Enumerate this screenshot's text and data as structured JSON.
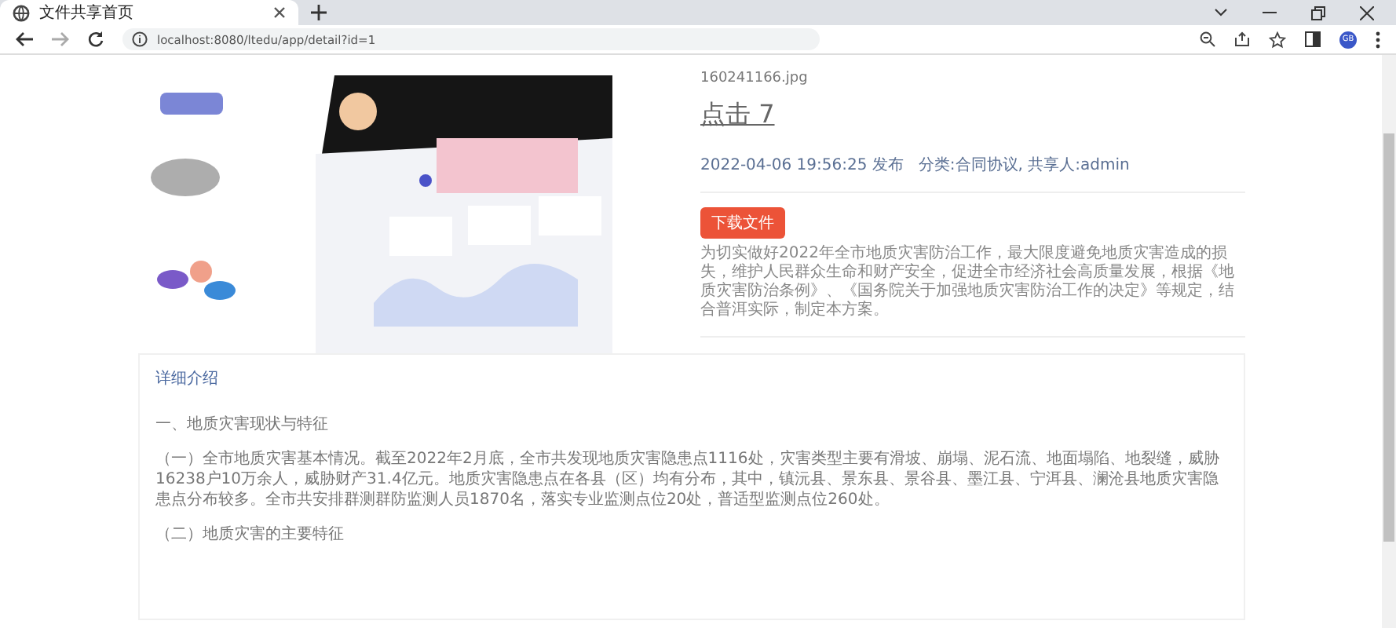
{
  "browser": {
    "tab": {
      "title": "文件共享首页",
      "selected": true
    },
    "address": "localhost:8080/ltedu/app/detail?id=1",
    "profile": "GB"
  },
  "file": {
    "filename": "160241166.jpg",
    "title": "点击 7",
    "meta": "2022-04-06 19:56:25 发布   分类:合同协议, 共享人:admin",
    "download": "下载文件",
    "summary": "为切实做好2022年全市地质灾害防治工作，最大限度避免地质灾害造成的损失，维护人民群众生命和财产安全，促进全市经济社会高质量发展，根据《地质灾害防治条例》、《国务院关于加强地质灾害防治工作的决定》等规定，结合普洱实际，制定本方案。"
  },
  "detail": {
    "heading": "详细介绍",
    "paragraphs": [
      "一、地质灾害现状与特征",
      "（一）全市地质灾害基本情况。截至2022年2月底，全市共发现地质灾害隐患点1116处，灾害类型主要有滑坡、崩塌、泥石流、地面塌陷、地裂缝，威胁16238户10万余人，威胁财产31.4亿元。地质灾害隐患点在各县（区）均有分布，其中，镇沅县、景东县、景谷县、墨江县、宁洱县、澜沧县地质灾害隐患点分布较多。全市共安排群测群防监测人员1870名，落实专业监测点位20处，普适型监测点位260处。",
      "（二）地质灾害的主要特征"
    ]
  }
}
